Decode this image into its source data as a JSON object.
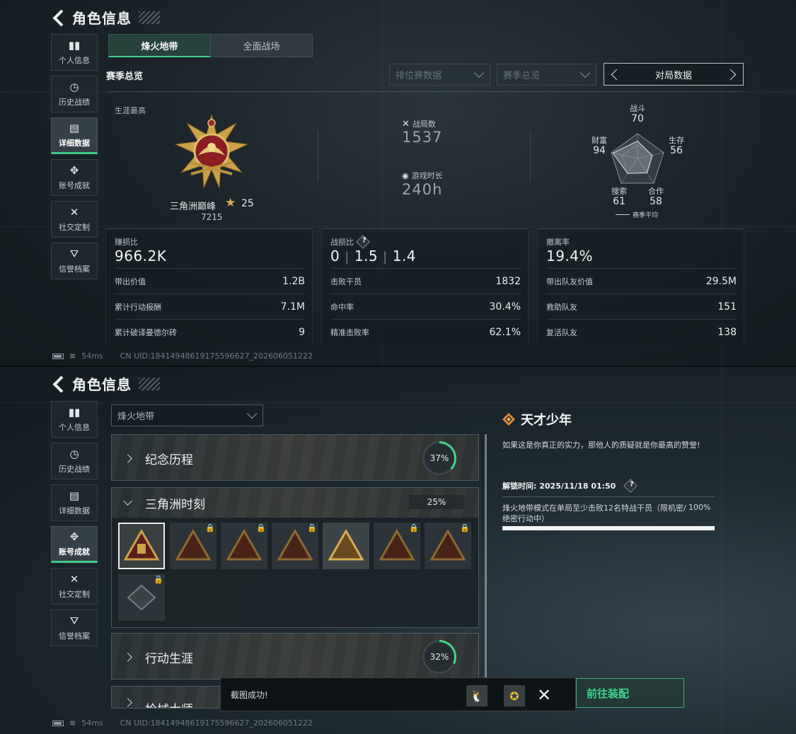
{
  "top": {
    "title": "角色信息",
    "sidebar": [
      {
        "icon": "bar-chart-icon",
        "glyph": "▮▮",
        "label": "个人信息"
      },
      {
        "icon": "history-icon",
        "glyph": "◷",
        "label": "历史战绩"
      },
      {
        "icon": "folder-icon",
        "glyph": "▤",
        "label": "详细数据",
        "active": true
      },
      {
        "icon": "achievement-icon",
        "glyph": "✥",
        "label": "账号成就"
      },
      {
        "icon": "tools-icon",
        "glyph": "✕",
        "label": "社交定制"
      },
      {
        "icon": "credit-icon",
        "glyph": "⛛",
        "label": "信誉档案"
      }
    ],
    "tabs": [
      "烽火地带",
      "全面战场"
    ],
    "section_title": "赛季总览",
    "dropdown_ranked": "排位赛数据",
    "dropdown_season": "赛季总览",
    "pager_label": "对局数据",
    "career_label": "生涯最高",
    "rank_name": "三角洲巅峰",
    "rank_stars": "25",
    "rank_score": "7215",
    "matches_label": "战局数",
    "matches_value": "1537",
    "playtime_label": "游戏时长",
    "playtime_value": "240h",
    "radar": {
      "combat": {
        "label": "战斗",
        "value": "70"
      },
      "survival": {
        "label": "生存",
        "value": "56"
      },
      "coop": {
        "label": "合作",
        "value": "58"
      },
      "search": {
        "label": "搜索",
        "value": "61"
      },
      "wealth": {
        "label": "财富",
        "value": "94"
      },
      "legend": "赛季平均"
    },
    "cards": [
      {
        "title": "赚损比",
        "big": "966.2K",
        "rows": [
          {
            "k": "带出价值",
            "v": "1.2B"
          },
          {
            "k": "累计行动报酬",
            "v": "7.1M"
          },
          {
            "k": "累计破译曼德尔砖",
            "v": "9"
          }
        ]
      },
      {
        "title": "战损比",
        "big_a": "0",
        "big_b": "1.5",
        "big_c": "1.4",
        "rows": [
          {
            "k": "击败干员",
            "v": "1832"
          },
          {
            "k": "命中率",
            "v": "30.4%"
          },
          {
            "k": "精准击败率",
            "v": "62.1%"
          }
        ]
      },
      {
        "title": "撤离率",
        "big": "19.4%",
        "rows": [
          {
            "k": "带出队友价值",
            "v": "29.5M"
          },
          {
            "k": "救助队友",
            "v": "151"
          },
          {
            "k": "复活队友",
            "v": "138"
          }
        ]
      }
    ],
    "footer_ping": "54ms",
    "footer_uid": "CN UID:18414948619175596627_202606051222"
  },
  "bottom": {
    "title": "角色信息",
    "sidebar": [
      {
        "icon": "bar-chart-icon",
        "glyph": "▮▮",
        "label": "个人信息"
      },
      {
        "icon": "history-icon",
        "glyph": "◷",
        "label": "历史战绩"
      },
      {
        "icon": "folder-icon",
        "glyph": "▤",
        "label": "详细数据"
      },
      {
        "icon": "achievement-icon",
        "glyph": "✥",
        "label": "账号成就",
        "active": true
      },
      {
        "icon": "tools-icon",
        "glyph": "✕",
        "label": "社交定制"
      },
      {
        "icon": "credit-icon",
        "glyph": "⛛",
        "label": "信誉档案"
      }
    ],
    "mode_dropdown": "烽火地带",
    "categories": [
      {
        "name": "纪念历程",
        "progress": "37%",
        "progress_value": 0.37
      },
      {
        "name": "三角洲时刻",
        "progress": "25%",
        "progress_value": 0.25
      },
      {
        "name": "行动生涯",
        "progress": "32%",
        "progress_value": 0.32
      },
      {
        "name": "枪械大师"
      }
    ],
    "detail": {
      "title": "天才少年",
      "desc": "如果这是你真正的实力，那他人的质疑就是你最高的赞誉!",
      "unlock": "解锁时间: 2025/11/18 01:50",
      "task": "烽火地带模式在单局至少击败12名特战干员（限机密/绝密行动中）",
      "task_pct": "100%",
      "task_progress": 1.0
    },
    "toast_msg": "截图成功!",
    "equip_button": "前往装配",
    "footer_ping": "54ms",
    "footer_uid": "CN UID:18414948619175596627_202606051222"
  },
  "colors": {
    "accent": "#3fd48d",
    "gold": "#d8b04a"
  }
}
